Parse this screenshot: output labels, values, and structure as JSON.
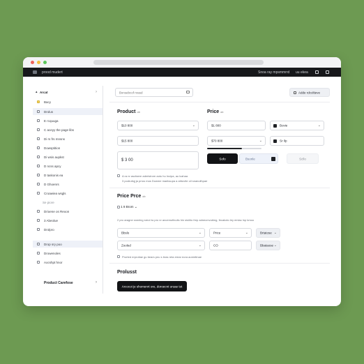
{
  "sidebar": {
    "header": "Arcat",
    "items": [
      {
        "label": "Bacy"
      },
      {
        "label": "Drolus"
      },
      {
        "label": "E rcquuga"
      },
      {
        "label": "C aceyy the page libs"
      },
      {
        "label": "Di rs frs mnsns"
      },
      {
        "label": "Dowsptition"
      },
      {
        "label": "Di wsis aupkst"
      },
      {
        "label": "D ncss apcy"
      },
      {
        "label": "D taskonis ea"
      },
      {
        "label": "D Ghoenrs"
      },
      {
        "label": "Croawiea wsgls"
      },
      {
        "label": "Se piore"
      },
      {
        "label": "Drioene os Reoon"
      },
      {
        "label": "3 Abeolue"
      },
      {
        "label": "Drolpro"
      },
      {
        "label": "Drop sry poo"
      },
      {
        "label": "Drowenoles"
      },
      {
        "label": "Aocshpt hnor"
      }
    ],
    "footer": "Product Carefose"
  },
  "topbar": {
    "left": "prood mudert",
    "right": [
      "Snoa ray mpsmmrrd",
      "uu ekea"
    ]
  },
  "toolbar": {
    "search_placeholder": "Bxnsebcof nrasd",
    "action_label": "Adde rdcoltieve"
  },
  "product": {
    "title": "Product",
    "title_suffix": "ob",
    "select1": "$10 800",
    "field1": "$15 800",
    "price_value": "$ 3 00"
  },
  "price": {
    "title": "Price",
    "title_suffix": "ob",
    "select1": "$1 800",
    "select2": "Bovie",
    "field1": "$70 800",
    "field2": "Sr Ilp",
    "btn_dark": "Sofo",
    "btn_mid": "Bsonle",
    "btn_light": "Scllo"
  },
  "notes": {
    "line1": "A ra nr ascfaere aderistrom aotu hu Incipa, au lcahaa",
    "line2": "3 podrutiqj ja prrus mos Dowme maeksupa a ahtuvite oil snanuilhpae"
  },
  "price_price": {
    "title": "Price Prce",
    "title_suffix": "ob",
    "dropdown": "1 8 Brom",
    "note": "2 pro aragne snwring sreoi iw pro nr ancemufinuits hin sisilrlo frep adnecmvubing, fecakoto ley emlac lnp kmoo",
    "row1_left": "Bbslo",
    "row1_mid": "Price",
    "row1_right": "Brtatose",
    "row2_left": "Zooled",
    "row2_mid": "CO",
    "row2_right": "Bbataose",
    "checkbox_note": "Prorted erprotiae gu bears pnu s bras reta erear eora aoredtinae"
  },
  "product_footer": {
    "title": "Prolusst",
    "button": "Arcocot je shomenrt ore, doroecnt uruae tot"
  }
}
